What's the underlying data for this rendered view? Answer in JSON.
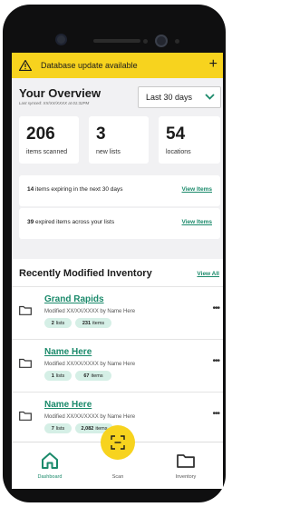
{
  "banner": {
    "text": "Database update available",
    "warn_icon": "warning-triangle-icon",
    "action_icon": "plus-icon",
    "color": "#f7d31e"
  },
  "overview": {
    "title": "Your Overview",
    "last_synced": "Last synced: XX/XX/XXXX at 01:32PM",
    "period": {
      "selected": "Last 30 days"
    },
    "stats": [
      {
        "value": "206",
        "label": "items scanned"
      },
      {
        "value": "3",
        "label": "new lists"
      },
      {
        "value": "54",
        "label": "locations"
      }
    ],
    "alerts": [
      {
        "count": "14",
        "text": " items expiring in the next 30 days",
        "link": "View Items"
      },
      {
        "count": "39",
        "text": " expired items across your lists",
        "link": "View Items"
      }
    ]
  },
  "recent": {
    "title": "Recently Modified Inventory",
    "view_all": "View All",
    "items": [
      {
        "name": "Grand Rapids",
        "modified": "Modified XX/XX/XXXX by Name Here",
        "lists_count": "2",
        "lists_label": "lists",
        "items_count": "231",
        "items_label": "items"
      },
      {
        "name": "Name Here",
        "modified": "Modified XX/XX/XXXX by Name Here",
        "lists_count": "1",
        "lists_label": "lists",
        "items_count": "67",
        "items_label": "items"
      },
      {
        "name": "Name Here",
        "modified": "Modified XX/XX/XXXX by Name Here",
        "lists_count": "7",
        "lists_label": "lists",
        "items_count": "2,082",
        "items_label": "items"
      }
    ]
  },
  "nav": {
    "items": [
      {
        "label": "Dashboard",
        "icon": "home-icon",
        "active": true
      },
      {
        "label": "Scan",
        "icon": "scan-icon",
        "active": false
      },
      {
        "label": "Inventory",
        "icon": "folder-icon",
        "active": false
      }
    ]
  },
  "colors": {
    "accent": "#1b8a6b",
    "yellow": "#f7d31e",
    "pill": "#d5efe6"
  }
}
